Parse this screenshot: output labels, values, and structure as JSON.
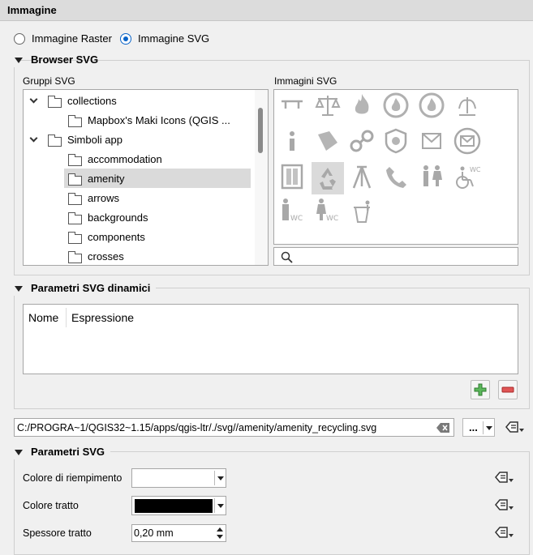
{
  "header": {
    "title": "Immagine"
  },
  "radios": {
    "raster_label": "Immagine Raster",
    "svg_label": "Immagine SVG",
    "selected": "svg"
  },
  "browser": {
    "title": "Browser SVG",
    "groups_label": "Gruppi SVG",
    "images_label": "Immagini SVG",
    "tree": [
      {
        "label": "collections",
        "level": 0,
        "expanded": true
      },
      {
        "label": "Mapbox's Maki Icons (QGIS ...",
        "level": 1
      },
      {
        "label": "Simboli app",
        "level": 0,
        "expanded": true
      },
      {
        "label": "accommodation",
        "level": 1
      },
      {
        "label": "amenity",
        "level": 1,
        "selected": true
      },
      {
        "label": "arrows",
        "level": 1
      },
      {
        "label": "backgrounds",
        "level": 1
      },
      {
        "label": "components",
        "level": 1
      },
      {
        "label": "crosses",
        "level": 1
      }
    ],
    "symbols": [
      "bench-icon",
      "scales-icon",
      "fire-icon",
      "fire-station-icon",
      "fire-station-2-icon",
      "fountain-icon",
      "information-icon",
      "library-icon",
      "handcuffs-icon",
      "police-icon",
      "post-box-icon",
      "post-office-icon",
      "phone-booth-icon",
      "recycling-icon",
      "survey-point-icon",
      "telephone-icon",
      "toilets-icon",
      "wheelchair-wc-icon",
      "toilet-men-icon",
      "toilet-women-icon",
      "waste-basket-icon"
    ],
    "selected_symbol": "recycling-icon",
    "search_placeholder": ""
  },
  "dynamic": {
    "title": "Parametri SVG dinamici",
    "columns": [
      "Nome",
      "Espressione"
    ]
  },
  "path": {
    "value": "C:/PROGRA~1/QGIS32~1.15/apps/qgis-ltr/./svg//amenity/amenity_recycling.svg",
    "browse_label": "..."
  },
  "svg_params": {
    "title": "Parametri SVG",
    "fill_label": "Colore di riempimento",
    "fill_color": "#ffffff",
    "stroke_label": "Colore tratto",
    "stroke_color": "#000000",
    "width_label": "Spessore tratto",
    "width_value": "0,20 mm"
  },
  "colors": {
    "accent": "#0a64c8",
    "selection": "#dadada",
    "add_green": "#3c9a3c",
    "remove_red": "#d23c3c"
  }
}
